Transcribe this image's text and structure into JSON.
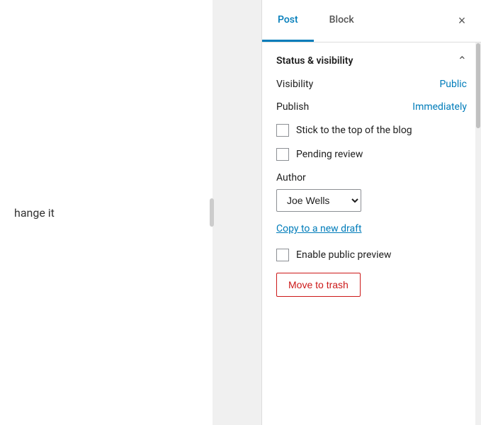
{
  "main": {
    "text": "hange it"
  },
  "sidebar": {
    "tabs": [
      {
        "id": "post",
        "label": "Post",
        "active": true
      },
      {
        "id": "block",
        "label": "Block",
        "active": false
      }
    ],
    "close_label": "×",
    "sections": {
      "status_visibility": {
        "title": "Status & visibility",
        "visibility_label": "Visibility",
        "visibility_value": "Public",
        "publish_label": "Publish",
        "publish_value": "Immediately",
        "stick_to_top_label": "Stick to the top of the blog",
        "pending_review_label": "Pending review",
        "author_label": "Author",
        "author_value": "Joe Wells",
        "copy_draft_label": "Copy to a new draft",
        "enable_preview_label": "Enable public preview",
        "move_trash_label": "Move to trash"
      }
    }
  }
}
